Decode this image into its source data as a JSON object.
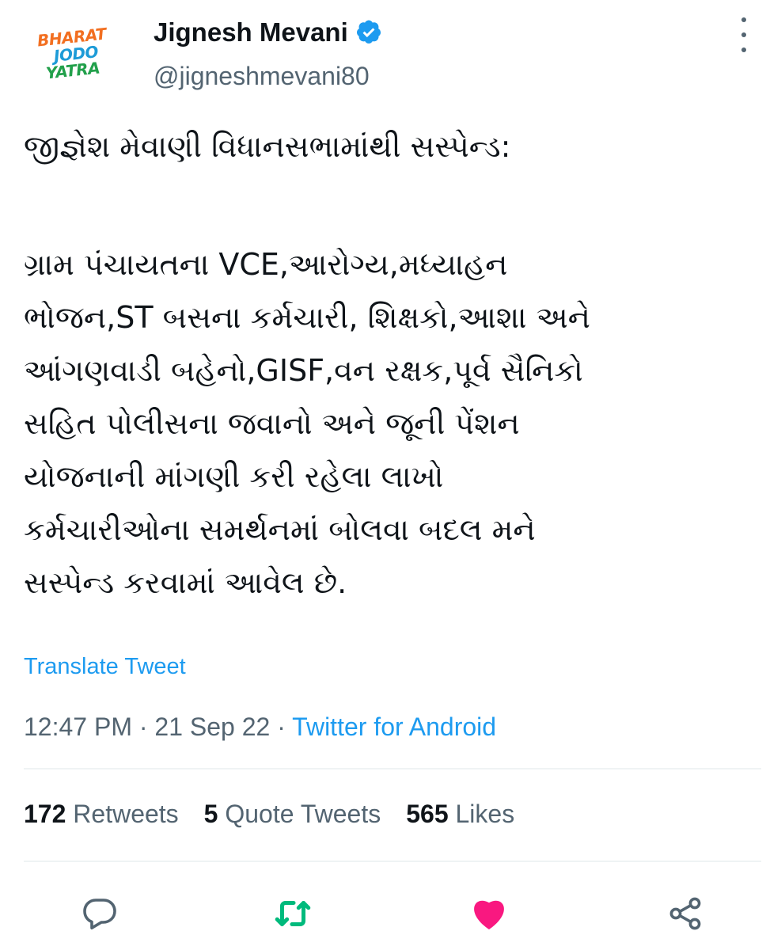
{
  "author": {
    "avatar_text": [
      "BHARAT",
      "JODO",
      "YATRA"
    ],
    "display_name": "Jignesh Mevani",
    "handle": "@jigneshmevani80",
    "verified": true
  },
  "tweet": {
    "lines": [
      "જીજ્ઞેશ મેવાણી વિધાનસભામાંથી સસ્પેન્ડ:",
      "",
      "ગ્રામ પંચાયતના VCE,આરોગ્ય,મધ્યાહન",
      "ભોજન,ST બસના કર્મચારી, શિક્ષકો,આશા અને",
      "આંગણવાડી બહેનો,GISF,વન રક્ષક,પૂર્વ સૈનિકો",
      "સહિત પોલીસના જવાનો અને જૂની પેંશન",
      "યોજનાની માંગણી કરી રહેલા લાખો",
      "કર્મચારીઓના સમર્થનમાં બોલવા બદલ મને",
      "સસ્પેન્ડ કરવામાં આવેલ છે."
    ],
    "translate_label": "Translate Tweet",
    "time": "12:47 PM",
    "date": "21 Sep 22",
    "separator": " · ",
    "source": "Twitter for Android"
  },
  "stats": {
    "retweets_count": "172",
    "retweets_label": "Retweets",
    "quotes_count": "5",
    "quotes_label": "Quote Tweets",
    "likes_count": "565",
    "likes_label": "Likes"
  },
  "actions": [
    {
      "icon": "reply-icon"
    },
    {
      "icon": "retweet-icon"
    },
    {
      "icon": "like-icon"
    },
    {
      "icon": "share-icon"
    }
  ],
  "colors": {
    "link_blue": "#1d9bf0",
    "retweet_green": "#00ba7c",
    "like_pink": "#f91880",
    "secondary_text": "#536471",
    "avatar_orange": "#f26f21",
    "avatar_blue": "#1d9bd7",
    "avatar_green": "#22a04b"
  }
}
